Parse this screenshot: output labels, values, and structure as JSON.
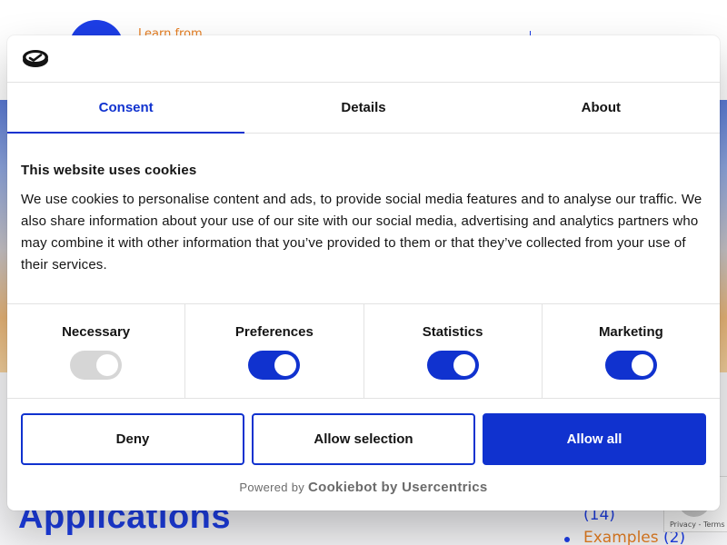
{
  "background": {
    "tagline": "Learn from",
    "heading": "Applications",
    "sidebar_count": "(14)",
    "sidebar_link": "Examples",
    "sidebar_link_count": "(2)",
    "recaptcha_text": "Privacy - Terms"
  },
  "dialog": {
    "brand_icon": "cookiebot-logo-icon",
    "tabs": [
      {
        "label": "Consent",
        "active": true
      },
      {
        "label": "Details",
        "active": false
      },
      {
        "label": "About",
        "active": false
      }
    ],
    "title": "This website uses cookies",
    "body": "We use cookies to personalise content and ads, to provide social media features and to analyse our traffic. We also share information about your use of our site with our social media, advertising and analytics partners who may combine it with other information that you’ve provided to them or that they’ve collected from your use of their services.",
    "toggles": [
      {
        "label": "Necessary",
        "state": "on-disabled"
      },
      {
        "label": "Preferences",
        "state": "on"
      },
      {
        "label": "Statistics",
        "state": "on"
      },
      {
        "label": "Marketing",
        "state": "on"
      }
    ],
    "buttons": {
      "deny": "Deny",
      "allow_selection": "Allow selection",
      "allow_all": "Allow all"
    },
    "footer": {
      "prefix": "Powered by",
      "brand": "Cookiebot by Usercentrics"
    }
  },
  "colors": {
    "accent": "#1032cf",
    "text": "#141414",
    "border": "#e2e2e2",
    "disabled_toggle": "#d6d6d6",
    "background_orange": "#e67e22"
  }
}
